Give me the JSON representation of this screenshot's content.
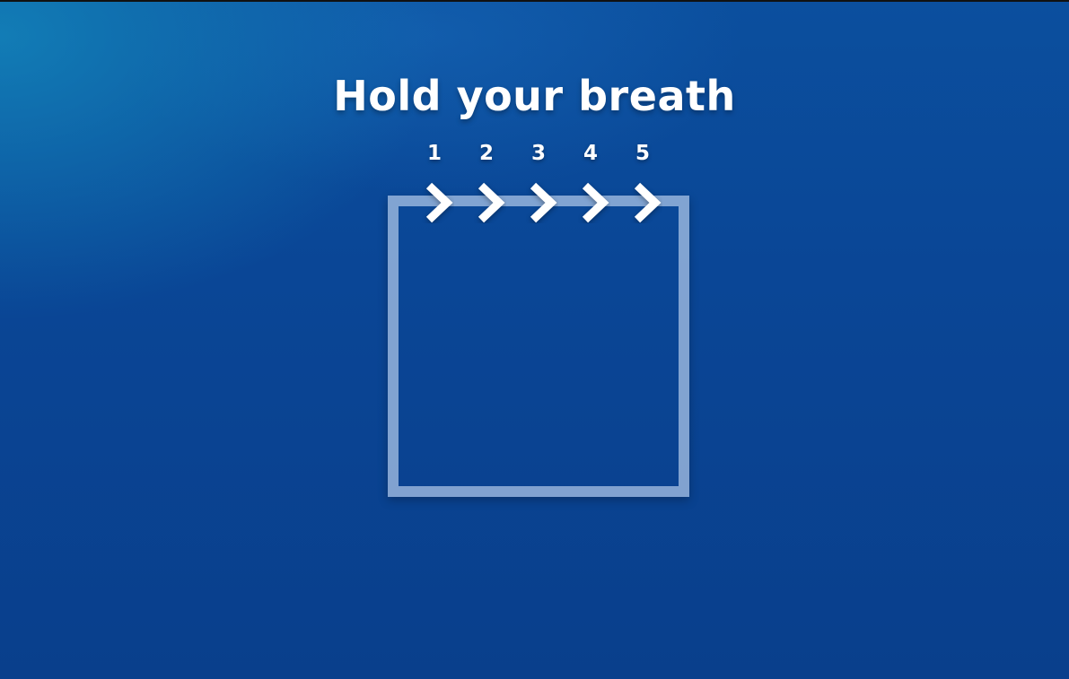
{
  "title": "Hold your breath",
  "steps": [
    "1",
    "2",
    "3",
    "4",
    "5"
  ],
  "icons": {
    "step_marker": "chevron-right-icon"
  },
  "colors": {
    "background": "#0a4696",
    "square": "#aac3e6",
    "text": "#ffffff"
  }
}
